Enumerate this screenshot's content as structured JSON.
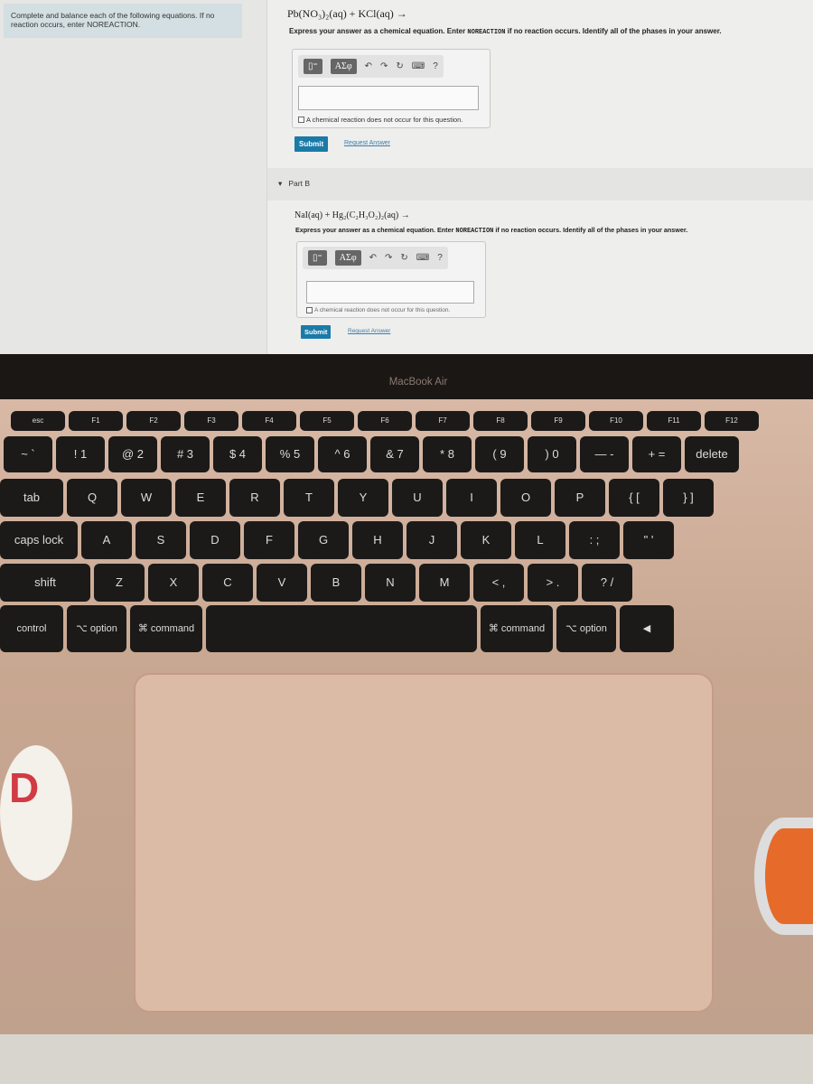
{
  "left_panel": {
    "instructions": "Complete and balance each of the following equations. If no reaction occurs, enter NOREACTION."
  },
  "part_a": {
    "equation": "Pb(NO₃)₂(aq) + KCl(aq) →",
    "hint_pre": "Express your answer as a chemical equation. Enter ",
    "hint_code": "NOREACTION",
    "hint_post": " if no reaction occurs. Identify all of the phases in your answer.",
    "toolbar": {
      "template": "▯⁼",
      "symbols": "ΑΣφ",
      "undo": "↶",
      "redo": "↷",
      "reset": "↻",
      "keyboard": "⌨",
      "help": "?"
    },
    "answer_value": "",
    "no_reaction_label": "A chemical reaction does not occur for this question.",
    "submit": "Submit",
    "request": "Request Answer"
  },
  "part_b": {
    "label": "Part B",
    "caret": "▾",
    "equation": "NaI(aq) + Hg₂(C₂H₃O₂)₂(aq) →",
    "hint_pre": "Express your answer as a chemical equation. Enter ",
    "hint_code": "NOREACTION",
    "hint_post": " if no reaction occurs. Identify all of the phases in your answer.",
    "toolbar": {
      "template": "▯⁼",
      "symbols": "ΑΣφ",
      "undo": "↶",
      "redo": "↷",
      "reset": "↻",
      "keyboard": "⌨",
      "help": "?"
    },
    "answer_value": "",
    "no_reaction_label": "A chemical reaction does not occur for this question.",
    "submit": "Submit",
    "request": "Request Answer"
  },
  "laptop_brand": "MacBook Air",
  "keyboard": {
    "rows": [
      [
        "esc",
        "F1",
        "F2",
        "F3",
        "F4",
        "F5",
        "F6",
        "F7",
        "F8",
        "F9",
        "F10",
        "F11",
        "F12"
      ],
      [
        "~ `",
        "! 1",
        "@ 2",
        "# 3",
        "$ 4",
        "% 5",
        "^ 6",
        "& 7",
        "* 8",
        "( 9",
        ") 0",
        "— -",
        "+ =",
        "delete"
      ],
      [
        "tab",
        "Q",
        "W",
        "E",
        "R",
        "T",
        "Y",
        "U",
        "I",
        "O",
        "P",
        "{ [",
        "} ]"
      ],
      [
        "caps lock",
        "A",
        "S",
        "D",
        "F",
        "G",
        "H",
        "J",
        "K",
        "L",
        ": ;",
        "\" '"
      ],
      [
        "shift",
        "Z",
        "X",
        "C",
        "V",
        "B",
        "N",
        "M",
        "< ,",
        "> .",
        "? /"
      ],
      [
        "control",
        "⌥ option",
        "⌘ command",
        "",
        "⌘ command",
        "⌥ option",
        "◀"
      ]
    ]
  }
}
